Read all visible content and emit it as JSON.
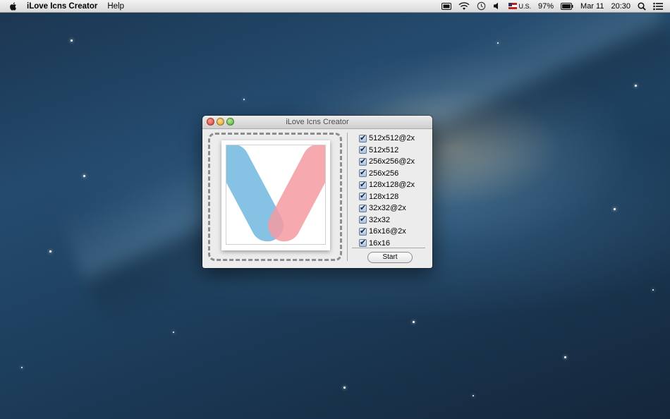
{
  "menubar": {
    "app_name": "iLove Icns Creator",
    "help_label": "Help",
    "input_source": "U.S.",
    "battery_percent": "97%",
    "date": "Mar 11",
    "time": "20:30"
  },
  "window": {
    "title": "iLove Icns Creator",
    "preview_icon": "v-logo",
    "sizes": [
      {
        "label": "512x512@2x",
        "checked": true
      },
      {
        "label": "512x512",
        "checked": true
      },
      {
        "label": "256x256@2x",
        "checked": true
      },
      {
        "label": "256x256",
        "checked": true
      },
      {
        "label": "128x128@2x",
        "checked": true
      },
      {
        "label": "128x128",
        "checked": true
      },
      {
        "label": "32x32@2x",
        "checked": true
      },
      {
        "label": "32x32",
        "checked": true
      },
      {
        "label": "16x16@2x",
        "checked": true
      },
      {
        "label": "16x16",
        "checked": true
      }
    ],
    "start_label": "Start"
  },
  "colors": {
    "logo_blue": "#7fbfe2",
    "logo_pink": "#f59ba1"
  }
}
